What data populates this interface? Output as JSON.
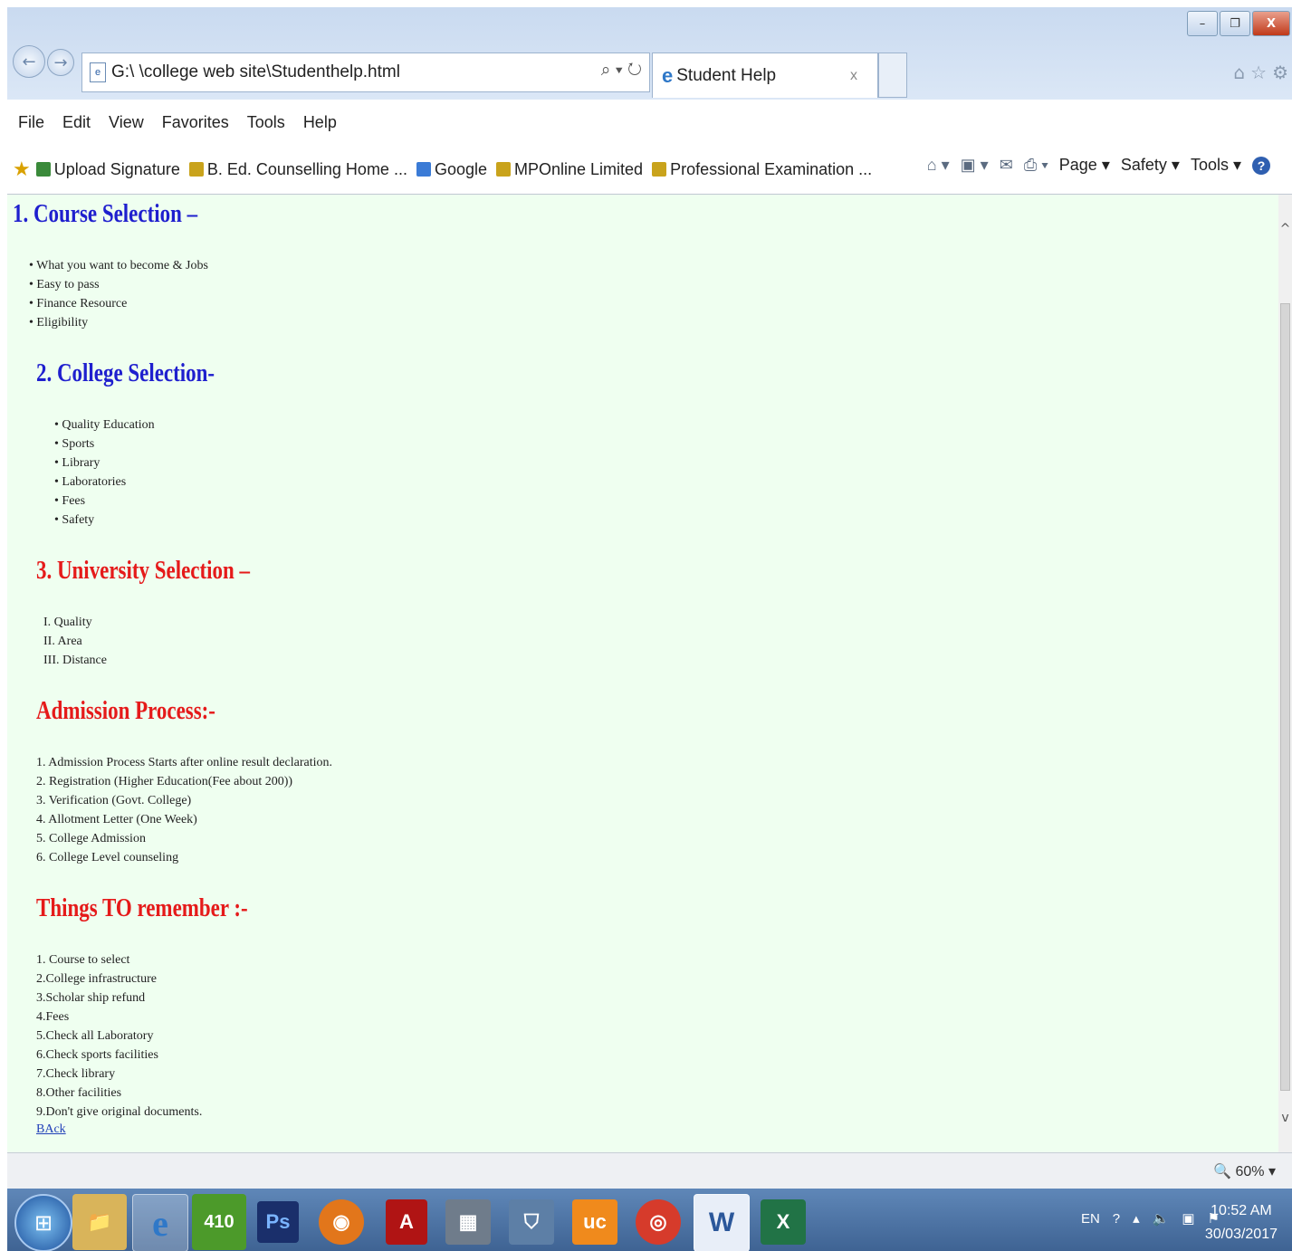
{
  "window": {
    "controls": {
      "minimize": "–",
      "restore": "❐",
      "close": "X"
    }
  },
  "navigation": {
    "back_glyph": "←",
    "forward_glyph": "→",
    "address": "G:\\ \\college web site\\Studenthelp.html",
    "address_tools": "⌕ ▾ ↻"
  },
  "tabs": [
    {
      "label": "Student Help",
      "close": "x"
    }
  ],
  "right_icons": [
    "⌂",
    "☆",
    "⚙"
  ],
  "menu": [
    "File",
    "Edit",
    "View",
    "Favorites",
    "Tools",
    "Help"
  ],
  "favorites": [
    {
      "label": "Upload Signature",
      "icon": "signature-icon",
      "color": "#3a8a3a"
    },
    {
      "label": "B. Ed. Counselling Home ...",
      "icon": "mp-icon",
      "color": "#c9a31c"
    },
    {
      "label": "Google",
      "icon": "google-icon",
      "color": "#3b7bd6"
    },
    {
      "label": "MPOnline Limited",
      "icon": "mp-icon",
      "color": "#c9a31c"
    },
    {
      "label": "Professional Examination ...",
      "icon": "mp-icon",
      "color": "#c9a31c"
    }
  ],
  "command_bar": {
    "page": "Page ▾",
    "safety": "Safety ▾",
    "tools": "Tools ▾",
    "help": "?"
  },
  "content": {
    "course_heading": "1. Course Selection –",
    "course_items": [
      "What you want to become & Jobs",
      "Easy to pass",
      "Finance Resource",
      "Eligibility"
    ],
    "college_heading": "2. College Selection-",
    "college_items": [
      "Quality Education",
      "Sports",
      "Library",
      "Laboratories",
      "Fees",
      "Safety"
    ],
    "university_heading": "3. University Selection –",
    "university_items": [
      "I.  Quality",
      "II.  Area",
      "III.  Distance"
    ],
    "admission_heading": "Admission Process:-",
    "admission_items": [
      "1. Admission Process Starts after online result declaration.",
      "2. Registration (Higher Education(Fee about 200))",
      "3. Verification (Govt. College)",
      "4. Allotment Letter (One Week)",
      "5. College Admission",
      "6. College Level counseling"
    ],
    "remember_heading": "Things TO remember :-",
    "remember_items": [
      "1. Course to select",
      "2.College infrastructure",
      "3.Scholar ship refund",
      "4.Fees",
      "5.Check all Laboratory",
      "6.Check sports facilities",
      "7.Check library",
      "8.Other facilities",
      "9.Don't give original documents."
    ],
    "back_link": "BAck"
  },
  "status": {
    "zoom": "60%"
  },
  "taskbar": {
    "apps": [
      {
        "name": "explorer",
        "label": "📁",
        "color": "#d9b45a"
      },
      {
        "name": "internet-explorer",
        "label": "e",
        "color": "#2f78c8",
        "active": true
      },
      {
        "name": "app-410",
        "label": "410",
        "color": "#4c9a2a"
      },
      {
        "name": "photoshop",
        "label": "Ps",
        "color": "#1a2f6b"
      },
      {
        "name": "firefox",
        "label": "◉",
        "color": "#e2761b"
      },
      {
        "name": "acrobat",
        "label": "A",
        "color": "#b01414"
      },
      {
        "name": "network",
        "label": "▦",
        "color": "#6f7c8b"
      },
      {
        "name": "shield",
        "label": "⛉",
        "color": "#5d7fa6"
      },
      {
        "name": "uc-browser",
        "label": "uc",
        "color": "#f08a1c"
      },
      {
        "name": "chrome",
        "label": "◎",
        "color": "#d63b2b"
      },
      {
        "name": "word",
        "label": "W",
        "color": "#2b579a",
        "active": true
      },
      {
        "name": "excel",
        "label": "X",
        "color": "#217346"
      }
    ],
    "tray_lang": "EN",
    "time": "10:52 AM",
    "date": "30/03/2017"
  }
}
